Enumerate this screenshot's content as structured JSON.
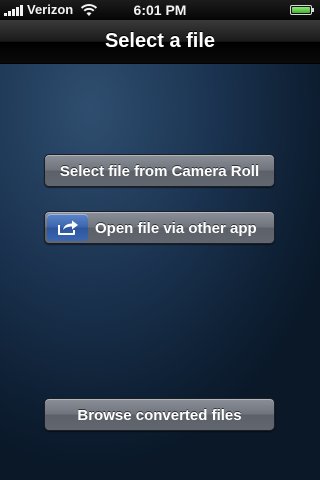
{
  "status_bar": {
    "carrier": "Verizon",
    "time": "6:01 PM",
    "battery_level": 1.0,
    "signal_bars": 5,
    "icons": [
      "signal-icon",
      "wifi-icon",
      "battery-icon"
    ]
  },
  "nav_bar": {
    "title": "Select a file"
  },
  "buttons": {
    "camera_roll": "Select file from Camera Roll",
    "open_other_app": "Open file via other app",
    "open_other_app_icon": "share-icon",
    "browse_converted": "Browse converted files"
  },
  "colors": {
    "background": "#1c3553",
    "button": "#6f747d",
    "share_icon_bg": "#3a64ad"
  }
}
